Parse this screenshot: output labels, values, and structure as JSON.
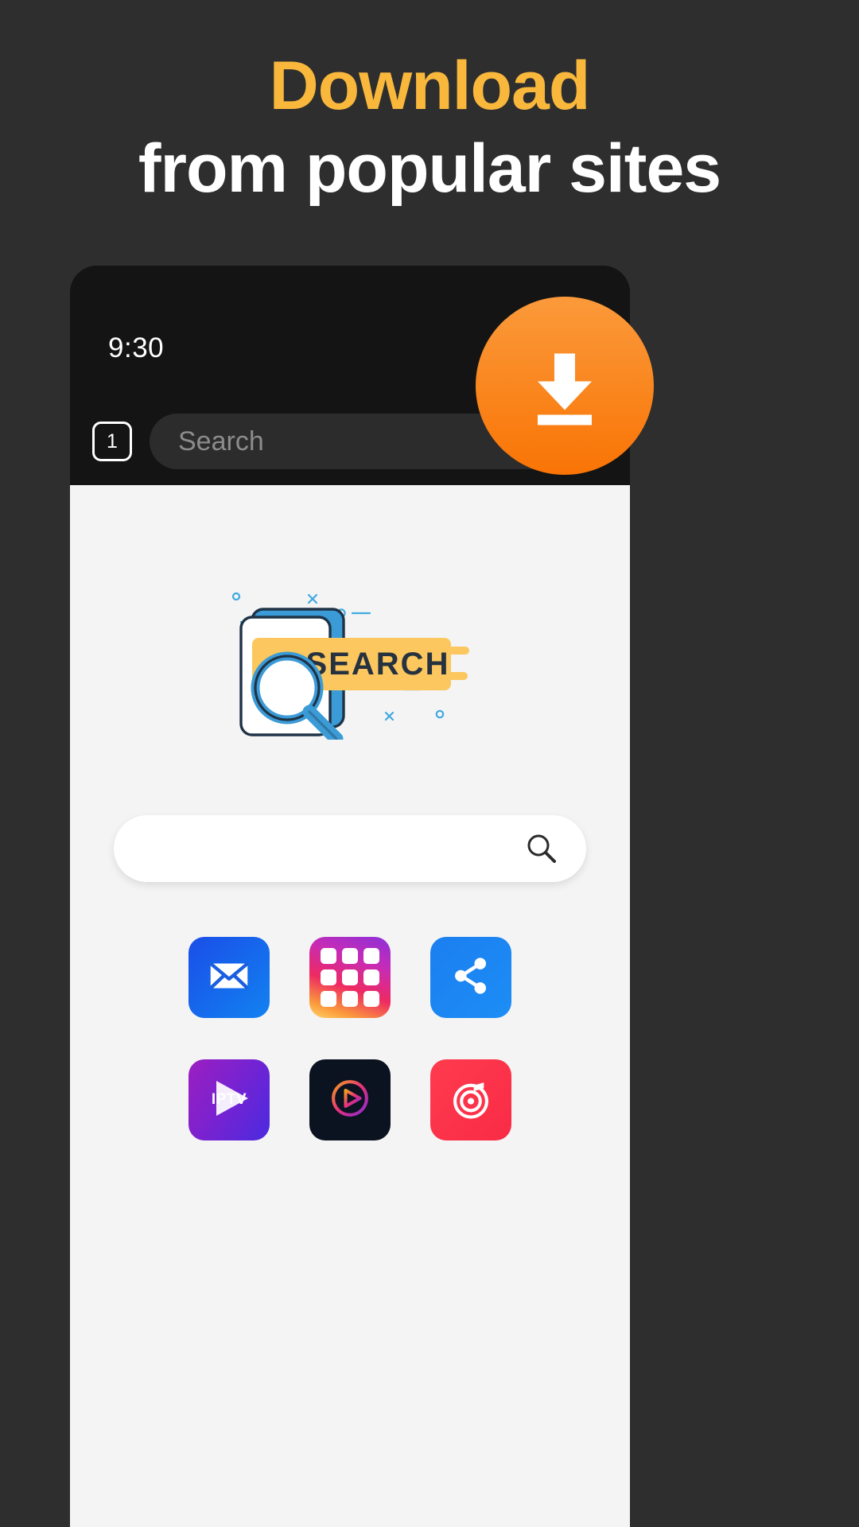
{
  "headline": {
    "line1": "Download",
    "line2": "from popular sites",
    "accent_color": "#f9b83c",
    "text_color": "#ffffff"
  },
  "background_color": "#2e2e2e",
  "phone": {
    "status_bar": {
      "time": "9:30"
    },
    "browser_toolbar": {
      "tab_count": "1",
      "omnibox_placeholder": "Search",
      "omnibox_value": "",
      "reload_icon": "reload-icon"
    },
    "page": {
      "illustration": {
        "banner_text": "SEARCH",
        "banner_color": "#fbc75e",
        "accent_color": "#3b9bd6"
      },
      "search_field": {
        "value": "",
        "placeholder": "",
        "icon": "magnifier-icon"
      },
      "shortcuts": [
        {
          "name": "mail-shortcut",
          "icon": "envelope-icon",
          "label": ""
        },
        {
          "name": "apps-grid-shortcut",
          "icon": "grid-icon",
          "label": ""
        },
        {
          "name": "share-shortcut",
          "icon": "share-icon",
          "label": ""
        },
        {
          "name": "iptv-shortcut",
          "icon": "play-triangle-icon",
          "label": "IPTV"
        },
        {
          "name": "video-player-shortcut",
          "icon": "play-circle-icon",
          "label": ""
        },
        {
          "name": "music-shortcut",
          "icon": "music-note-icon",
          "label": ""
        }
      ]
    }
  },
  "download_badge": {
    "icon": "download-arrow-icon",
    "color_top": "#fb9a3b",
    "color_bottom": "#f97405"
  }
}
